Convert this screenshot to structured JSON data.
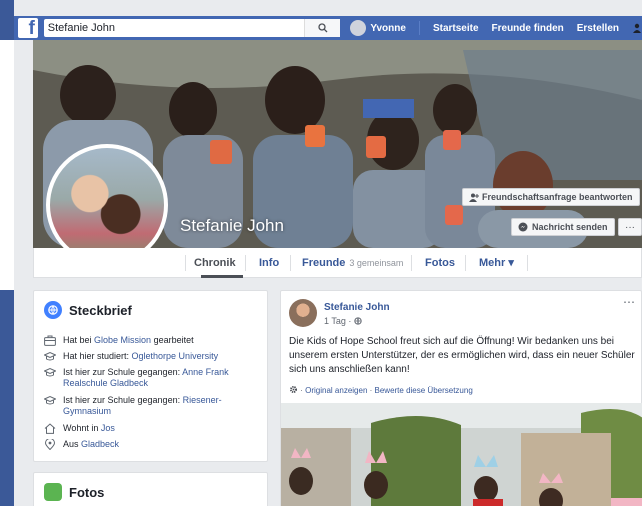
{
  "topbar": {
    "logo": "f",
    "search_value": "Stefanie John",
    "user_name": "Yvonne",
    "nav": [
      "Startseite",
      "Freunde finden",
      "Erstellen"
    ]
  },
  "cover": {
    "name": "Stefanie John",
    "friend_request_button": "Freundschaftsanfrage beantworten",
    "message_button": "Nachricht senden",
    "more_button": "···"
  },
  "tabs": {
    "chronik": "Chronik",
    "info": "Info",
    "freunde": "Freunde",
    "freunde_sub": "3 gemeinsam",
    "fotos": "Fotos",
    "mehr": "Mehr ▾"
  },
  "intro": {
    "title": "Steckbrief",
    "rows": [
      {
        "prefix": "Hat bei ",
        "link": "Globe Mission",
        "suffix": " gearbeitet"
      },
      {
        "prefix": "Hat hier studiert: ",
        "link": "Oglethorpe University",
        "suffix": ""
      },
      {
        "prefix": "Ist hier zur Schule gegangen: ",
        "link": "Anne Frank",
        "link2": "Realschule Gladbeck"
      },
      {
        "prefix": "Ist hier zur Schule gegangen: ",
        "link": "Riesener-",
        "link2": "Gymnasium"
      },
      {
        "prefix": "Wohnt in ",
        "link": "Jos",
        "suffix": ""
      },
      {
        "prefix": "Aus ",
        "link": "Gladbeck",
        "suffix": ""
      }
    ]
  },
  "photos": {
    "title": "Fotos"
  },
  "post": {
    "author": "Stefanie John",
    "time": "1 Tag · ",
    "text": "Die Kids of Hope School freut sich auf die Öffnung! Wir bedanken uns bei unserem ersten Unterstützer, der es ermöglichen wird, dass ein neuer Schüler sich uns anschließen kann!",
    "translate_show": "Original anzeigen",
    "translate_rate": "Bewerte diese Übersetzung",
    "translate_sep": " · "
  },
  "colors": {
    "brand": "#4267b2",
    "link": "#385898",
    "background": "#e9ebee"
  }
}
